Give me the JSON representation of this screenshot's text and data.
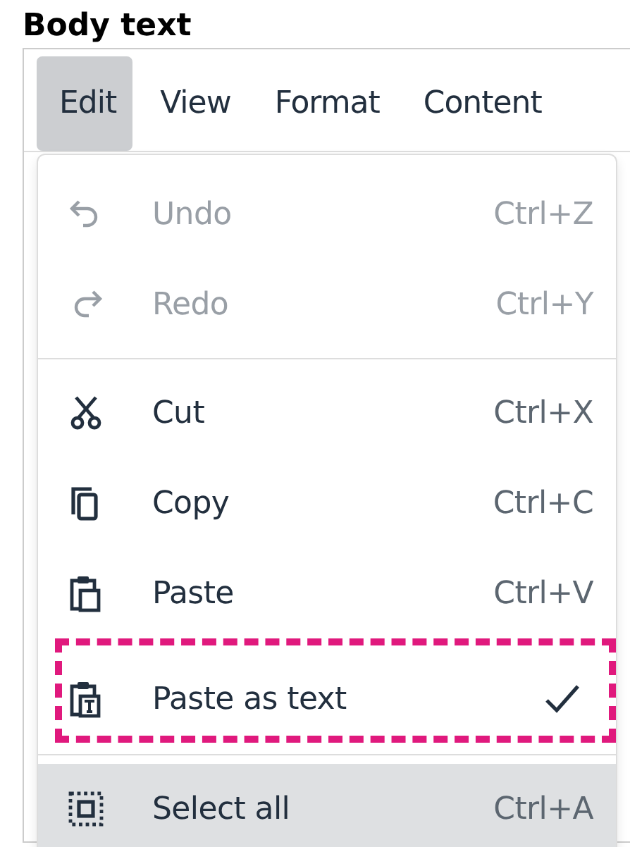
{
  "field_label": "Body text",
  "menubar": [
    {
      "label": "Edit",
      "selected": true
    },
    {
      "label": "View",
      "selected": false
    },
    {
      "label": "Format",
      "selected": false
    },
    {
      "label": "Content",
      "selected": false
    }
  ],
  "menu": [
    {
      "kind": "command",
      "label": "Undo",
      "shortcut": "Ctrl+Z",
      "disabled": true,
      "hovered": false,
      "checked": false,
      "outlined": false
    },
    {
      "kind": "command",
      "label": "Redo",
      "shortcut": "Ctrl+Y",
      "disabled": true,
      "hovered": false,
      "checked": false,
      "outlined": false
    },
    {
      "kind": "separator"
    },
    {
      "kind": "command",
      "label": "Cut",
      "shortcut": "Ctrl+X",
      "disabled": false,
      "hovered": false,
      "checked": false,
      "outlined": false
    },
    {
      "kind": "command",
      "label": "Copy",
      "shortcut": "Ctrl+C",
      "disabled": false,
      "hovered": false,
      "checked": false,
      "outlined": false
    },
    {
      "kind": "command",
      "label": "Paste",
      "shortcut": "Ctrl+V",
      "disabled": false,
      "hovered": false,
      "checked": false,
      "outlined": false
    },
    {
      "kind": "command",
      "label": "Paste as text",
      "disabled": false,
      "hovered": false,
      "checked": true,
      "outlined": true
    },
    {
      "kind": "separator"
    },
    {
      "kind": "command",
      "label": "Select all",
      "shortcut": "Ctrl+A",
      "disabled": false,
      "hovered": true,
      "checked": false,
      "outlined": false
    }
  ]
}
